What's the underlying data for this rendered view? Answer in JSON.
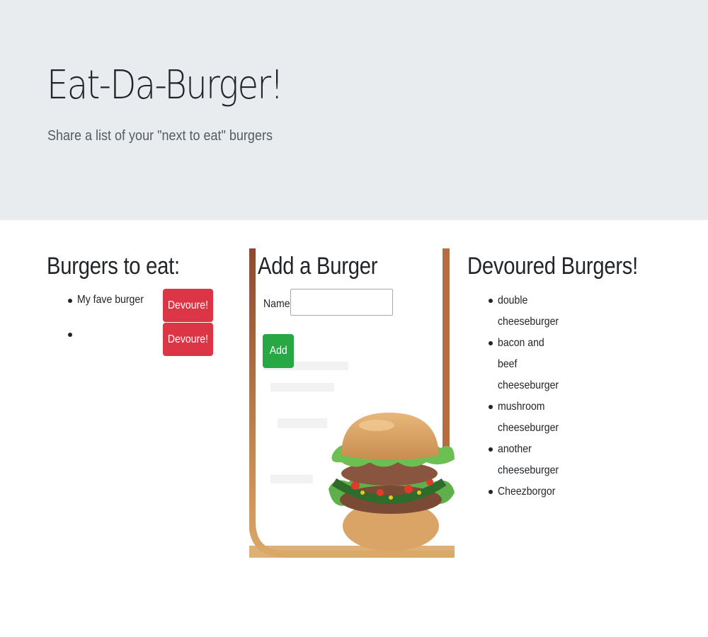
{
  "header": {
    "title": "Eat-Da-Burger!",
    "lead": "Share a list of your \"next to eat\" burgers"
  },
  "to_eat": {
    "heading": "Burgers to eat:",
    "items": [
      {
        "name": "My fave burger",
        "button": "Devoure!"
      },
      {
        "name": "",
        "button": "Devoure!"
      }
    ]
  },
  "add_form": {
    "heading": "Add a Burger",
    "name_label": "Name:",
    "name_value": "",
    "submit_label": "Add"
  },
  "devoured": {
    "heading": "Devoured Burgers!",
    "items": [
      "double cheeseburger",
      "bacon and beef cheeseburger",
      "mushroom cheeseburger",
      "another cheeseburger",
      "Cheezborgor"
    ]
  },
  "colors": {
    "jumbotron_bg": "#e9ecef",
    "devour_button": "#dc3545",
    "add_button": "#28a745"
  }
}
